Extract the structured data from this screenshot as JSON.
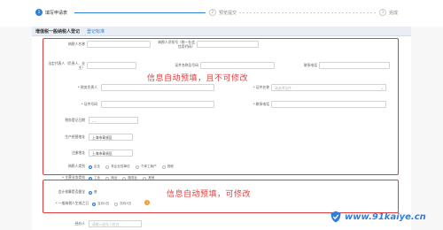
{
  "steps": [
    {
      "num": "1",
      "label": "填写申请表"
    },
    {
      "num": "2",
      "label": "预览提交"
    },
    {
      "num": "3",
      "label": "完成"
    }
  ],
  "title": {
    "text": "增值税一般纳税人登记",
    "link": "登记标准"
  },
  "notes": {
    "top": "信息自动预填，且不可修改",
    "bottom": "信息自动预填，可修改"
  },
  "fields": {
    "taxpayer_name": {
      "label": "纳税人名称",
      "value": ""
    },
    "taxpayer_id": {
      "label": "纳税人识别号（统一社会信用代码）",
      "value": ""
    },
    "legal_rep": {
      "label": "法定代表人（负责人、业主）",
      "value": ""
    },
    "cert_name_id": {
      "label": "证件名称及号码",
      "value": ""
    },
    "contact_phone_1": {
      "label": "联系电话",
      "value": ""
    },
    "finance_head": {
      "label": "* 财务负责人",
      "value": ""
    },
    "cert_name": {
      "label": "* 证件名称",
      "placeholder": "请选择证件"
    },
    "cert_no": {
      "label": "* 证件号码",
      "value": ""
    },
    "contact_phone_2": {
      "label": "* 联系电话",
      "value": ""
    },
    "tax_reg_date": {
      "label": "税务登记日期",
      "value": "- -"
    },
    "business_addr": {
      "label": "生产经营地址",
      "value": "上海市奉贤区"
    },
    "reg_addr": {
      "label": "注册地址",
      "value": "上海市奉贤区"
    },
    "taxpayer_category": {
      "label": "纳税人类别",
      "options": [
        "企业",
        "非企业性单位",
        "个体工商户",
        "其他"
      ],
      "selected": 0
    },
    "main_business": {
      "label": "* 主营业务类别",
      "options": [
        "工业",
        "商业",
        "服务业",
        "其他"
      ],
      "selected": 0
    },
    "accounting_sound": {
      "label": "会计核算是否健全",
      "options": [
        "是"
      ],
      "selected": 0
    },
    "effective_period": {
      "label": "* 一般纳税人生效之日",
      "options": [
        "当月1日",
        "次月1日"
      ],
      "selected": 0
    },
    "handler": {
      "label": "经办人",
      "placeholder": "请输入经办人姓名"
    }
  },
  "help_icon": "?",
  "watermark": {
    "text": "www.91kaiye.cn"
  },
  "colors": {
    "accent": "#2f7fd8",
    "alert": "#e43c3c",
    "help": "#f39a2c"
  }
}
